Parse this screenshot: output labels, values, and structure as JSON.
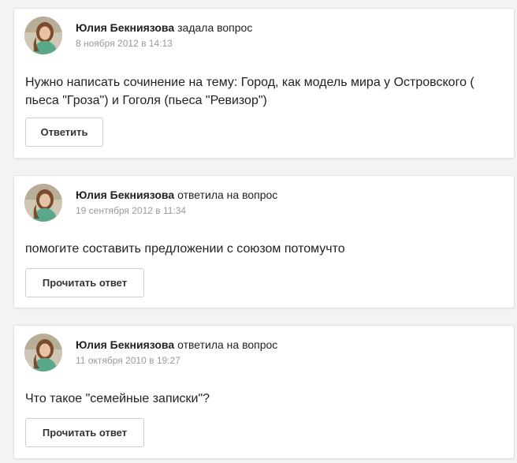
{
  "feed": {
    "items": [
      {
        "author": "Юлия Бекниязова",
        "action": "задала вопрос",
        "date": "8 ноября 2012 в 14:13",
        "text": "Нужно написать сочинение на тему: Город, как модель мира у Островского ( пьеса \"Гроза\") и Гоголя (пьеса \"Ревизор\")",
        "button_label": "Ответить"
      },
      {
        "author": "Юлия Бекниязова",
        "action": "ответила на вопрос",
        "date": "19 сентября 2012 в 11:34",
        "text": "помогите составить предложении с союзом потомучто",
        "button_label": "Прочитать ответ"
      },
      {
        "author": "Юлия Бекниязова",
        "action": "ответила на вопрос",
        "date": "11 октября 2010 в 19:27",
        "text": "Что такое \"семейные записки\"?",
        "button_label": "Прочитать ответ"
      }
    ]
  }
}
